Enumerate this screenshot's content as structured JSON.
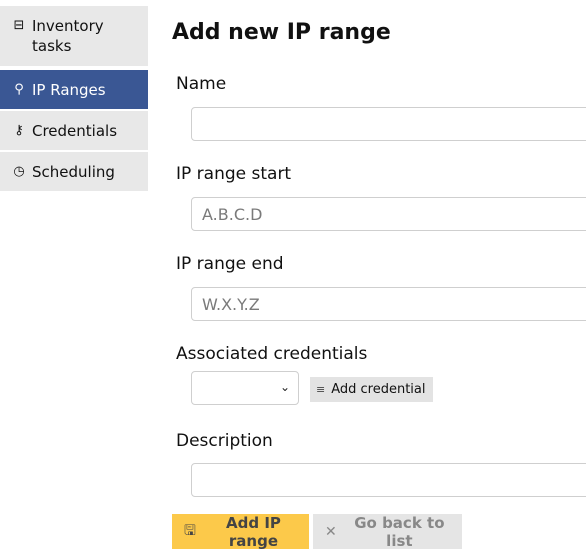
{
  "sidebar": {
    "items": [
      {
        "icon": "inventory-tasks-icon",
        "glyph": "⊟",
        "label": "Inventory\ntasks"
      },
      {
        "icon": "ip-ranges-icon",
        "glyph": "⚲",
        "label": "IP Ranges"
      },
      {
        "icon": "key-icon",
        "glyph": "⚷",
        "label": "Credentials"
      },
      {
        "icon": "clock-icon",
        "glyph": "◷",
        "label": "Scheduling"
      }
    ],
    "active_color": "#3a5794"
  },
  "form": {
    "title": "Add new IP range",
    "name": {
      "label": "Name",
      "value": "",
      "placeholder": ""
    },
    "start": {
      "label": "IP range start",
      "value": "",
      "placeholder": "A.B.C.D"
    },
    "end": {
      "label": "IP range end",
      "value": "",
      "placeholder": "W.X.Y.Z"
    },
    "credentials": {
      "label": "Associated credentials",
      "selected": "",
      "add_label": "Add credential",
      "add_icon": "≡"
    },
    "description": {
      "label": "Description",
      "value": "",
      "placeholder": ""
    },
    "submit_label": "Add IP range",
    "back_label": "Go back to list",
    "submit_color": "#fcc94a"
  }
}
